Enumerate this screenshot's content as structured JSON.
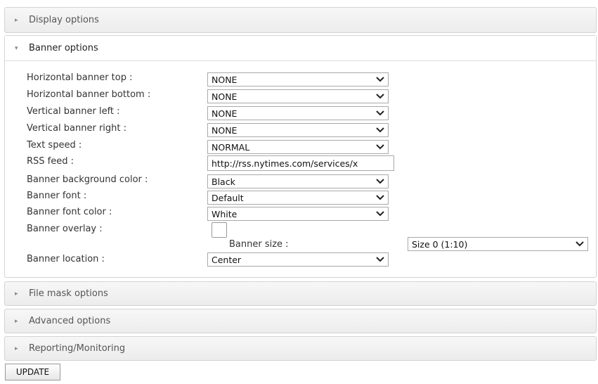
{
  "sections": {
    "display": {
      "label": "Display options"
    },
    "banner": {
      "label": "Banner options"
    },
    "filemask": {
      "label": "File mask options"
    },
    "advanced": {
      "label": "Advanced options"
    },
    "reporting": {
      "label": "Reporting/Monitoring"
    }
  },
  "banner": {
    "h_top": {
      "label": "Horizontal banner top :",
      "value": "NONE"
    },
    "h_bottom": {
      "label": "Horizontal banner bottom :",
      "value": "NONE"
    },
    "v_left": {
      "label": "Vertical banner left :",
      "value": "NONE"
    },
    "v_right": {
      "label": "Vertical banner right :",
      "value": "NONE"
    },
    "text_speed": {
      "label": "Text speed :",
      "value": "NORMAL"
    },
    "rss_feed": {
      "label": "RSS feed :",
      "value": "http://rss.nytimes.com/services/x"
    },
    "bg_color": {
      "label": "Banner background color :",
      "value": "Black"
    },
    "font": {
      "label": "Banner font :",
      "value": "Default"
    },
    "font_color": {
      "label": "Banner font color :",
      "value": "White"
    },
    "overlay": {
      "label": "Banner overlay :",
      "checked": false
    },
    "size": {
      "label": "Banner size :",
      "value": "Size 0 (1:10)"
    },
    "location": {
      "label": "Banner location :",
      "value": "Center"
    }
  },
  "actions": {
    "update_label": "UPDATE"
  }
}
